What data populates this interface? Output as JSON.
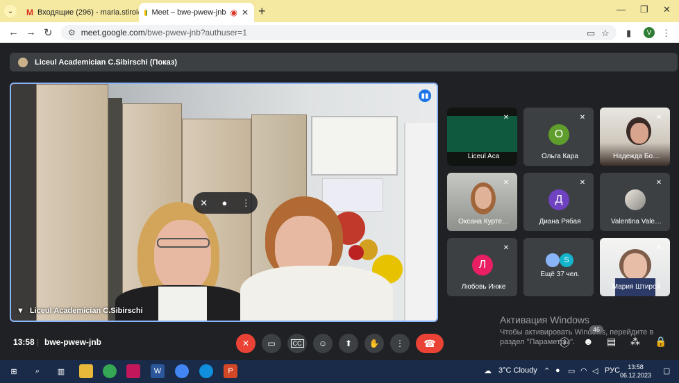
{
  "browser": {
    "tabs": [
      {
        "title": "Входящие (296) - maria.stiroi@",
        "favicon": "gmail-icon"
      },
      {
        "title": "Meet – bwe-pwew-jnb",
        "favicon": "meet-icon",
        "active": true
      }
    ],
    "url": {
      "host": "meet.google.com",
      "path": "/bwe-pwew-jnb?authuser=1"
    },
    "profile_initial": "V"
  },
  "meet": {
    "presenting_label": "Liceul Academician C.Sibirschi (Показ)",
    "main_tile_name": "Liceul Academician C.Sibirschi",
    "participants": [
      {
        "name": "Liceul Aca",
        "kind": "screen"
      },
      {
        "name": "Ольга Кара",
        "kind": "avatar",
        "initial": "О",
        "color": "#5f9e2c"
      },
      {
        "name": "Надежда Бо…",
        "kind": "photo"
      },
      {
        "name": "Оксана Курте…",
        "kind": "photo"
      },
      {
        "name": "Диана Рябая",
        "kind": "avatar",
        "initial": "Д",
        "color": "#6f42c1"
      },
      {
        "name": "Valentina Vale…",
        "kind": "photo"
      },
      {
        "name": "Любовь Инже",
        "kind": "avatar",
        "initial": "Л",
        "color": "#e91e63"
      },
      {
        "name": "Ещё 37 чел.",
        "kind": "more",
        "initial": "S"
      },
      {
        "name": "Мария Штирой",
        "kind": "photo"
      }
    ],
    "time": "13:58",
    "separator": "|",
    "meeting_code": "bwe-pwew-jnb",
    "people_count": "46",
    "windows_watermark": {
      "line1": "Активация Windows",
      "line2": "Чтобы активировать Windows, перейдите в",
      "line3": "раздел \"Параметры\"."
    }
  },
  "taskbar": {
    "weather": "3°C  Cloudy",
    "language": "РУС",
    "time": "13:58",
    "date": "06.12.2023"
  }
}
